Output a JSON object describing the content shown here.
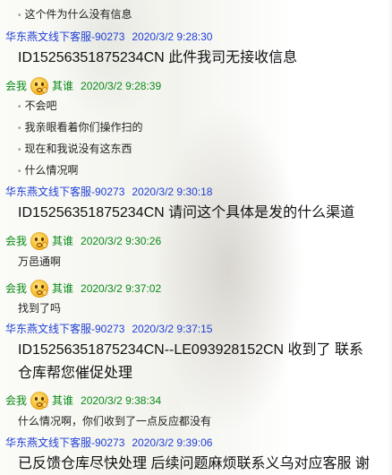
{
  "messages": [
    {
      "kind": "text",
      "text": "这个件为什么没有信息",
      "dot": true
    },
    {
      "kind": "staff",
      "name": "华东燕文线下客服-90273",
      "time": "2020/3/2 9:28:30"
    },
    {
      "kind": "big",
      "text": "ID15256351875234CN 此件我司无接收信息"
    },
    {
      "kind": "me",
      "prefix": "会我",
      "who": "其谁",
      "time": "2020/3/2 9:28:39"
    },
    {
      "kind": "text",
      "text": "不会吧",
      "dot": true
    },
    {
      "kind": "text",
      "text": "我亲眼看着你们操作扫的",
      "dot": true
    },
    {
      "kind": "text",
      "text": "现在和我说没有这东西",
      "dot": true
    },
    {
      "kind": "text",
      "text": "什么情况啊",
      "dot": true
    },
    {
      "kind": "staff",
      "name": "华东燕文线下客服-90273",
      "time": "2020/3/2 9:30:18"
    },
    {
      "kind": "big",
      "text": "ID15256351875234CN 请问这个具体是发的什么渠道"
    },
    {
      "kind": "me",
      "prefix": "会我",
      "who": "其谁",
      "time": "2020/3/2 9:30:26"
    },
    {
      "kind": "text",
      "text": "万邑通啊",
      "dot": false
    },
    {
      "kind": "me",
      "prefix": "会我",
      "who": "其谁",
      "time": "2020/3/2 9:37:02"
    },
    {
      "kind": "text",
      "text": "找到了吗",
      "dot": false
    },
    {
      "kind": "staff",
      "name": "华东燕文线下客服-90273",
      "time": "2020/3/2 9:37:15"
    },
    {
      "kind": "big",
      "text": "ID15256351875234CN--LE093928152CN 收到了 联系"
    },
    {
      "kind": "big",
      "text": "仓库帮您催促处理"
    },
    {
      "kind": "me",
      "prefix": "会我",
      "who": "其谁",
      "time": "2020/3/2 9:38:34"
    },
    {
      "kind": "text",
      "text": "什么情况啊，你们收到了一点反应都没有",
      "dot": false
    },
    {
      "kind": "staff",
      "name": "华东燕文线下客服-90273",
      "time": "2020/3/2 9:39:06"
    },
    {
      "kind": "big",
      "text": "已反馈仓库尽快处理 后续问题麻烦联系义乌对应客服 谢"
    }
  ]
}
